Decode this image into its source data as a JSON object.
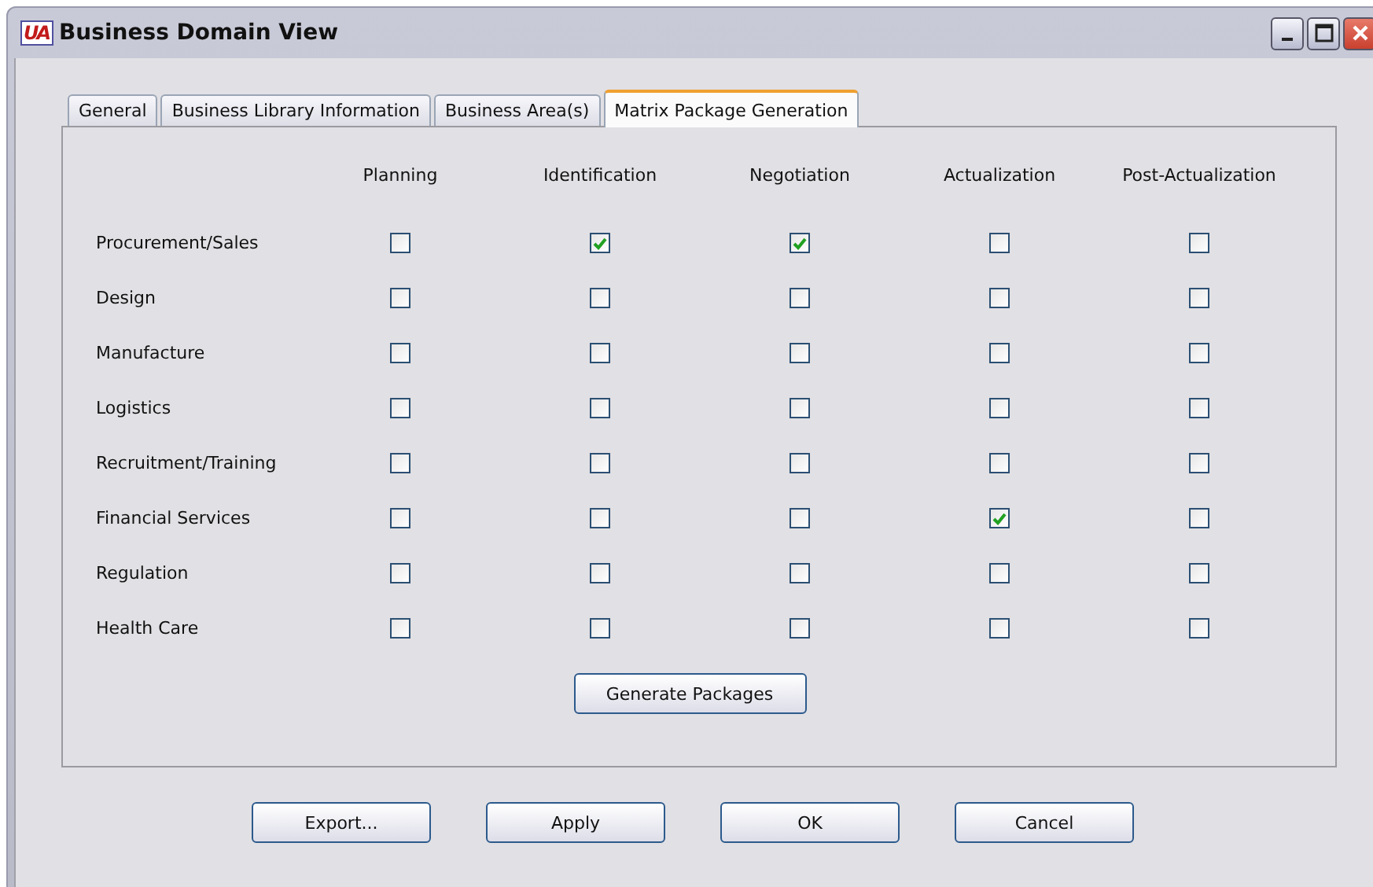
{
  "window": {
    "logo": "UA",
    "title": "Business Domain View"
  },
  "tabs": [
    {
      "label": "General",
      "selected": false
    },
    {
      "label": "Business Library Information",
      "selected": false
    },
    {
      "label": "Business Area(s)",
      "selected": false
    },
    {
      "label": "Matrix Package Generation",
      "selected": true
    }
  ],
  "matrix": {
    "columns": [
      "Planning",
      "Identification",
      "Negotiation",
      "Actualization",
      "Post-Actualization"
    ],
    "rows": [
      {
        "label": "Procurement/Sales",
        "checked": [
          false,
          true,
          true,
          false,
          false
        ]
      },
      {
        "label": "Design",
        "checked": [
          false,
          false,
          false,
          false,
          false
        ]
      },
      {
        "label": "Manufacture",
        "checked": [
          false,
          false,
          false,
          false,
          false
        ]
      },
      {
        "label": "Logistics",
        "checked": [
          false,
          false,
          false,
          false,
          false
        ]
      },
      {
        "label": "Recruitment/Training",
        "checked": [
          false,
          false,
          false,
          false,
          false
        ]
      },
      {
        "label": "Financial Services",
        "checked": [
          false,
          false,
          false,
          true,
          false
        ]
      },
      {
        "label": "Regulation",
        "checked": [
          false,
          false,
          false,
          false,
          false
        ]
      },
      {
        "label": "Health Care",
        "checked": [
          false,
          false,
          false,
          false,
          false
        ]
      }
    ]
  },
  "generate_button": "Generate Packages",
  "buttons": [
    "Export...",
    "Apply",
    "OK",
    "Cancel"
  ]
}
